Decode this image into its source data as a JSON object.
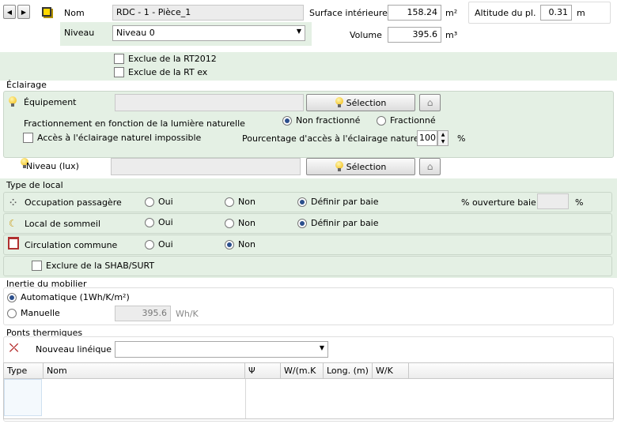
{
  "header": {
    "name_label": "Nom",
    "name_value": "RDC - 1 - Pièce_1",
    "surface_label": "Surface intérieure",
    "surface_value": "158.24",
    "surface_unit": "m²",
    "altitude_label": "Altitude du pl.",
    "altitude_value": "0.31",
    "altitude_unit": "m",
    "niveau_label": "Niveau",
    "niveau_value": "Niveau 0",
    "volume_label": "Volume",
    "volume_value": "395.6",
    "volume_unit": "m³"
  },
  "exclusions": {
    "rt2012_label": "Exclue de la RT2012",
    "rtex_label": "Exclue de la RT ex"
  },
  "eclairage": {
    "title": "Éclairage",
    "equipement_label": "Équipement",
    "selection_label": "Sélection",
    "fractionnement_label": "Fractionnement en fonction de la lumière naturelle",
    "non_fractionne_label": "Non fractionné",
    "fractionne_label": "Fractionné",
    "acces_impossible_label": "Accès à l'éclairage naturel impossible",
    "pourcentage_label": "Pourcentage d'accès à l'éclairage naturel",
    "pourcentage_value": "100",
    "pourcentage_unit": "%",
    "niveau_lux_label": "Niveau (lux)",
    "selection2_label": "Sélection"
  },
  "type_local": {
    "title": "Type de local",
    "oui": "Oui",
    "non": "Non",
    "definir": "Définir par baie",
    "occupation_label": "Occupation passagère",
    "ouverture_label": "% ouverture baie",
    "ouverture_unit": "%",
    "sommeil_label": "Local de sommeil",
    "circulation_label": "Circulation commune",
    "exclure_shab_label": "Exclure de la SHAB/SURT"
  },
  "inertie": {
    "title": "Inertie du mobilier",
    "automatique_label": "Automatique (1Wh/K/m²)",
    "manuelle_label": "Manuelle",
    "manuelle_value": "395.6",
    "manuelle_unit": "Wh/K"
  },
  "ponts": {
    "title": "Ponts thermiques",
    "nouveau_label": "Nouveau linéique",
    "columns": [
      "Type",
      "Nom",
      "Ψ",
      "W/(m.K",
      "Long. (m)",
      "W/K"
    ]
  }
}
